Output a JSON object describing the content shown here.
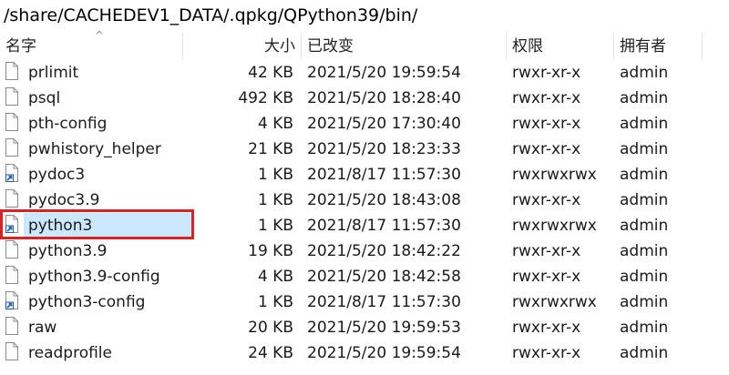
{
  "path_value": "/share/CACHEDEV1_DATA/.qpkg/QPython39/bin/",
  "columns": {
    "name": "名字",
    "size": "大小",
    "modified": "已改变",
    "permissions": "权限",
    "owner": "拥有者"
  },
  "sort_arrow": "^",
  "colors": {
    "selection": "#cce8ff",
    "highlight_border": "#e02020",
    "shortcut_arrow": "#1a5fb4"
  },
  "files": [
    {
      "name": "prlimit",
      "size": "42 KB",
      "modified": "2021/5/20 19:59:54",
      "permissions": "rwxr-xr-x",
      "owner": "admin",
      "icon": "file-icon"
    },
    {
      "name": "psql",
      "size": "492 KB",
      "modified": "2021/5/20 18:28:40",
      "permissions": "rwxr-xr-x",
      "owner": "admin",
      "icon": "file-icon"
    },
    {
      "name": "pth-config",
      "size": "4 KB",
      "modified": "2021/5/20 17:30:40",
      "permissions": "rwxr-xr-x",
      "owner": "admin",
      "icon": "file-icon"
    },
    {
      "name": "pwhistory_helper",
      "size": "21 KB",
      "modified": "2021/5/20 18:23:33",
      "permissions": "rwxr-xr-x",
      "owner": "admin",
      "icon": "file-icon"
    },
    {
      "name": "pydoc3",
      "size": "1 KB",
      "modified": "2021/8/17 11:57:30",
      "permissions": "rwxrwxrwx",
      "owner": "admin",
      "icon": "shortcut-icon"
    },
    {
      "name": "pydoc3.9",
      "size": "1 KB",
      "modified": "2021/5/20 18:43:08",
      "permissions": "rwxr-xr-x",
      "owner": "admin",
      "icon": "file-icon"
    },
    {
      "name": "python3",
      "size": "1 KB",
      "modified": "2021/8/17 11:57:30",
      "permissions": "rwxrwxrwx",
      "owner": "admin",
      "icon": "shortcut-icon",
      "selected": true
    },
    {
      "name": "python3.9",
      "size": "19 KB",
      "modified": "2021/5/20 18:42:22",
      "permissions": "rwxr-xr-x",
      "owner": "admin",
      "icon": "file-icon"
    },
    {
      "name": "python3.9-config",
      "size": "4 KB",
      "modified": "2021/5/20 18:42:58",
      "permissions": "rwxr-xr-x",
      "owner": "admin",
      "icon": "file-icon"
    },
    {
      "name": "python3-config",
      "size": "1 KB",
      "modified": "2021/8/17 11:57:30",
      "permissions": "rwxrwxrwx",
      "owner": "admin",
      "icon": "shortcut-icon"
    },
    {
      "name": "raw",
      "size": "20 KB",
      "modified": "2021/5/20 19:59:53",
      "permissions": "rwxr-xr-x",
      "owner": "admin",
      "icon": "file-icon"
    },
    {
      "name": "readprofile",
      "size": "24 KB",
      "modified": "2021/5/20 19:59:54",
      "permissions": "rwxr-xr-x",
      "owner": "admin",
      "icon": "file-icon"
    }
  ]
}
